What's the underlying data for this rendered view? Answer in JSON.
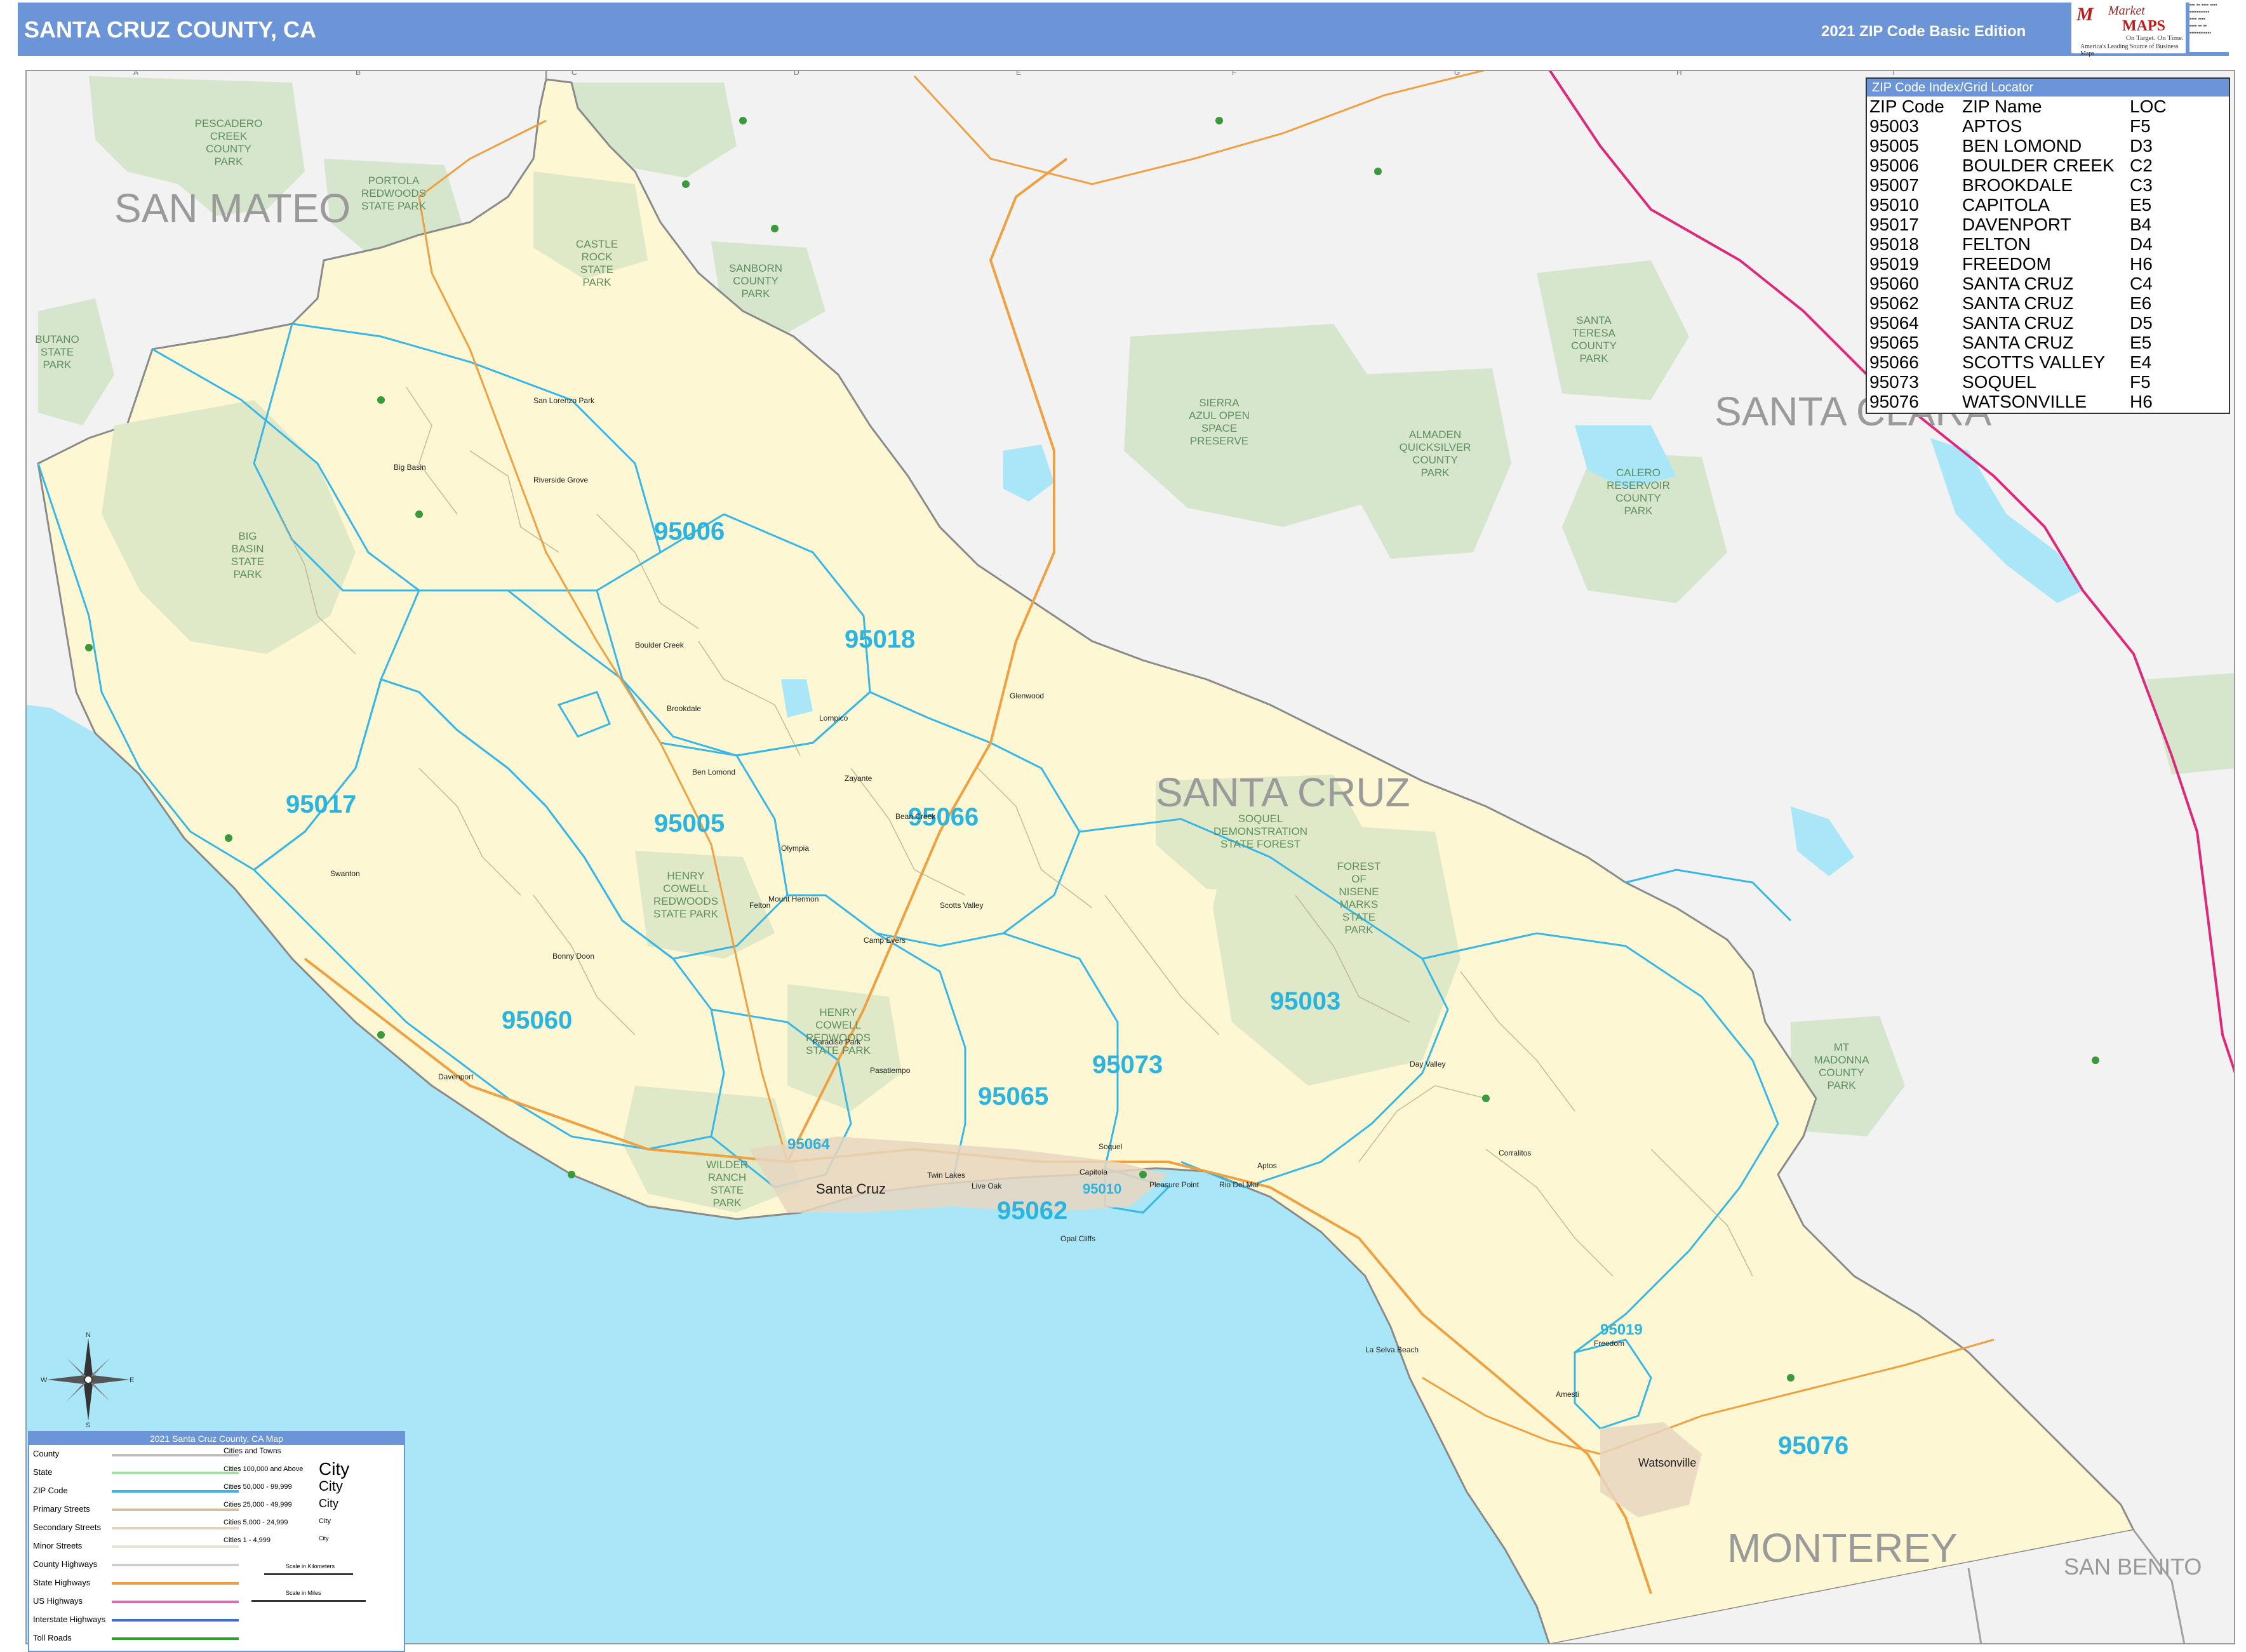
{
  "header": {
    "title": "SANTA CRUZ COUNTY, CA",
    "edition": "2021 ZIP Code Basic Edition"
  },
  "logo": {
    "word1": "Market",
    "word2": "MAPS",
    "tagline1": "On Target. On Time.",
    "tagline2": "America's Leading Source of Business Maps"
  },
  "colors": {
    "header_blue": "#6c95d8",
    "ocean": "#a8e6f8",
    "county_fill": "#fdf8d3",
    "outside_fill": "#f2f2f2",
    "park_green": "#d6e6cc",
    "zip_line": "#37b7e7",
    "state_highway": "#f0a040",
    "interstate": "#e0287a"
  },
  "map": {
    "county_labels": [
      {
        "text": "SAN MATEO"
      },
      {
        "text": "SANTA CLARA"
      },
      {
        "text": "SANTA CRUZ"
      },
      {
        "text": "MONTEREY"
      },
      {
        "text": "SAN BENITO"
      }
    ],
    "zip_labels": [
      "95006",
      "95018",
      "95017",
      "95005",
      "95066",
      "95060",
      "95003",
      "95073",
      "95065",
      "95064",
      "95062",
      "95010",
      "95019",
      "95076"
    ],
    "parks": [
      {
        "lines": [
          "PESCADERO",
          "CREEK",
          "COUNTY",
          "PARK"
        ]
      },
      {
        "lines": [
          "PORTOLA",
          "REDWOODS",
          "STATE PARK"
        ]
      },
      {
        "lines": [
          "CASTLE",
          "ROCK",
          "STATE",
          "PARK"
        ]
      },
      {
        "lines": [
          "SANBORN",
          "COUNTY",
          "PARK"
        ]
      },
      {
        "lines": [
          "BUTANO",
          "STATE",
          "PARK"
        ]
      },
      {
        "lines": [
          "BIG",
          "BASIN",
          "STATE",
          "PARK"
        ]
      },
      {
        "lines": [
          "SIERRA",
          "AZUL OPEN",
          "SPACE",
          "PRESERVE"
        ]
      },
      {
        "lines": [
          "ALMADEN",
          "QUICKSILVER",
          "COUNTY",
          "PARK"
        ]
      },
      {
        "lines": [
          "SANTA",
          "TERESA",
          "COUNTY",
          "PARK"
        ]
      },
      {
        "lines": [
          "CALERO",
          "RESERVOIR",
          "COUNTY",
          "PARK"
        ]
      },
      {
        "lines": [
          "SOQUEL",
          "DEMONSTRATION",
          "STATE FOREST"
        ]
      },
      {
        "lines": [
          "FOREST",
          "OF",
          "NISENE",
          "MARKS",
          "STATE",
          "PARK"
        ]
      },
      {
        "lines": [
          "HENRY",
          "COWELL",
          "REDWOODS",
          "STATE PARK"
        ]
      },
      {
        "lines": [
          "HENRY",
          "COWELL",
          "REDWOODS",
          "STATE PARK"
        ]
      },
      {
        "lines": [
          "WILDER",
          "RANCH",
          "STATE",
          "PARK"
        ]
      },
      {
        "lines": [
          "MT",
          "MADONNA",
          "COUNTY",
          "PARK"
        ]
      }
    ],
    "cities": [
      "Santa Cruz",
      "Watsonville",
      "San Lorenzo Park",
      "Big Basin",
      "Riverside Grove",
      "Boulder Creek",
      "Brookdale",
      "Ben Lomond",
      "Felton",
      "Zayante",
      "Lompico",
      "Glenwood",
      "Bonny Doon",
      "Davenport",
      "Swanton",
      "Scotts Valley",
      "Soquel",
      "Capitola",
      "Aptos",
      "Rio Del Mar",
      "La Selva Beach",
      "Freedom",
      "Corralitos",
      "Opal Cliffs",
      "Live Oak",
      "Twin Lakes",
      "Pasatiempo",
      "Paradise Park",
      "Mount Hermon",
      "Olympia",
      "Bean Creek",
      "Camp Evers",
      "Day Valley",
      "Amesti",
      "Pleasure Point"
    ],
    "grid_columns": [
      "A",
      "B",
      "C",
      "D",
      "E",
      "F",
      "G",
      "H",
      "I"
    ],
    "grid_rows": [
      "1",
      "2",
      "3",
      "4",
      "5",
      "6",
      "7"
    ]
  },
  "zip_index": {
    "header": "ZIP Code Index/Grid Locator",
    "columns": [
      "ZIP Code",
      "ZIP Name",
      "LOC"
    ],
    "rows": [
      [
        "95003",
        "APTOS",
        "F5"
      ],
      [
        "95005",
        "BEN LOMOND",
        "D3"
      ],
      [
        "95006",
        "BOULDER CREEK",
        "C2"
      ],
      [
        "95007",
        "BROOKDALE",
        "C3"
      ],
      [
        "95010",
        "CAPITOLA",
        "E5"
      ],
      [
        "95017",
        "DAVENPORT",
        "B4"
      ],
      [
        "95018",
        "FELTON",
        "D4"
      ],
      [
        "95019",
        "FREEDOM",
        "H6"
      ],
      [
        "95060",
        "SANTA CRUZ",
        "C4"
      ],
      [
        "95062",
        "SANTA CRUZ",
        "E6"
      ],
      [
        "95064",
        "SANTA CRUZ",
        "D5"
      ],
      [
        "95065",
        "SANTA CRUZ",
        "E5"
      ],
      [
        "95066",
        "SCOTTS VALLEY",
        "E4"
      ],
      [
        "95073",
        "SOQUEL",
        "F5"
      ],
      [
        "95076",
        "WATSONVILLE",
        "H6"
      ]
    ]
  },
  "legend": {
    "header": "2021 Santa Cruz County, CA Map",
    "items": [
      "County",
      "State",
      "ZIP Code",
      "Primary Streets",
      "Secondary Streets",
      "Minor Streets",
      "County Highways",
      "State Highways",
      "US Highways",
      "Interstate Highways",
      "Toll Roads"
    ],
    "city_header": "Cities and Towns",
    "city_classes": [
      {
        "label": "Cities 100,000 and Above",
        "sample": "City"
      },
      {
        "label": "Cities 50,000 - 99,999",
        "sample": "City"
      },
      {
        "label": "Cities 25,000 - 49,999",
        "sample": "City"
      },
      {
        "label": "Cities 5,000 - 24,999",
        "sample": "City"
      },
      {
        "label": "Cities 1 - 4,999",
        "sample": "City"
      }
    ],
    "scale_km": "Scale in Kilometers",
    "scale_mi": "Scale in Miles"
  },
  "compass": {
    "n": "N",
    "s": "S",
    "e": "E",
    "w": "W"
  }
}
